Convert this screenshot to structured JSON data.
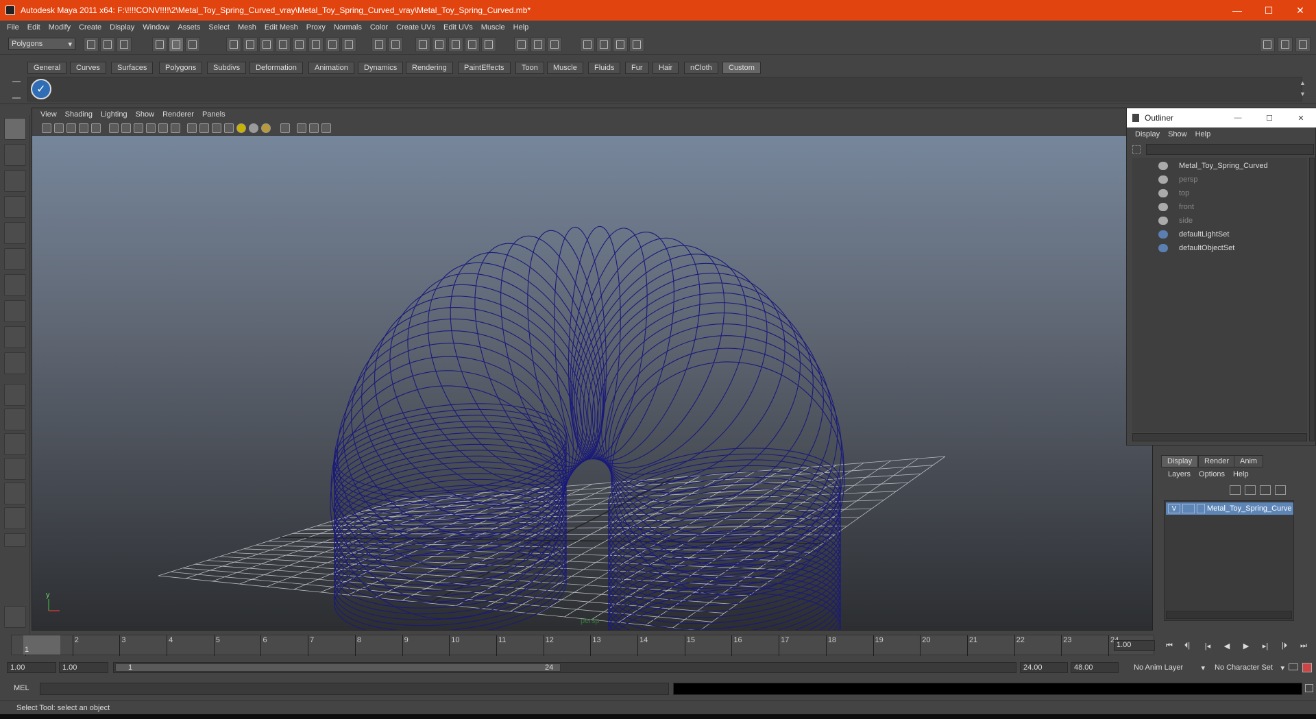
{
  "window": {
    "title": "Autodesk Maya 2011 x64: F:\\!!!!CONV!!!!\\2\\Metal_Toy_Spring_Curved_vray\\Metal_Toy_Spring_Curved_vray\\Metal_Toy_Spring_Curved.mb*",
    "minimize": "—",
    "maximize": "☐",
    "close": "✕"
  },
  "menubar": [
    "File",
    "Edit",
    "Modify",
    "Create",
    "Display",
    "Window",
    "Assets",
    "Select",
    "Mesh",
    "Edit Mesh",
    "Proxy",
    "Normals",
    "Color",
    "Create UVs",
    "Edit UVs",
    "Muscle",
    "Help"
  ],
  "statusline": {
    "mode": "Polygons"
  },
  "shelf": {
    "tabs": [
      "General",
      "Curves",
      "Surfaces",
      "Polygons",
      "Subdivs",
      "Deformation",
      "Animation",
      "Dynamics",
      "Rendering",
      "PaintEffects",
      "Toon",
      "Muscle",
      "Fluids",
      "Fur",
      "Hair",
      "nCloth",
      "Custom"
    ],
    "active": "Custom"
  },
  "viewport": {
    "menu": [
      "View",
      "Shading",
      "Lighting",
      "Show",
      "Renderer",
      "Panels"
    ],
    "camera_label": "persp",
    "axis_y": "y",
    "axis_x": "x",
    "wire_color": "#1a1a7a"
  },
  "outliner": {
    "title": "Outliner",
    "menu": [
      "Display",
      "Show",
      "Help"
    ],
    "items": [
      {
        "label": "Metal_Toy_Spring_Curved",
        "dim": false
      },
      {
        "label": "persp",
        "dim": true
      },
      {
        "label": "top",
        "dim": true
      },
      {
        "label": "front",
        "dim": true
      },
      {
        "label": "side",
        "dim": true
      },
      {
        "label": "defaultLightSet",
        "dim": false
      },
      {
        "label": "defaultObjectSet",
        "dim": false
      }
    ]
  },
  "layers": {
    "tabs": [
      "Display",
      "Render",
      "Anim"
    ],
    "active": "Display",
    "menu": [
      "Layers",
      "Options",
      "Help"
    ],
    "layer_visible": "V",
    "layer_name": "Metal_Toy_Spring_Curve"
  },
  "timeline": {
    "ticks": [
      "1",
      "2",
      "3",
      "4",
      "5",
      "6",
      "7",
      "8",
      "9",
      "10",
      "11",
      "12",
      "13",
      "14",
      "15",
      "16",
      "17",
      "18",
      "19",
      "20",
      "21",
      "22",
      "23",
      "24"
    ],
    "current_frame": "1.00",
    "playhead": "1"
  },
  "range": {
    "start": "1.00",
    "playback_start": "1.00",
    "slider_start": "1",
    "slider_end": "24",
    "playback_end": "24.00",
    "end": "48.00",
    "anim_layer": "No Anim Layer",
    "char_set": "No Character Set"
  },
  "cmd": {
    "label": "MEL"
  },
  "helpline": "Select Tool: select an object"
}
